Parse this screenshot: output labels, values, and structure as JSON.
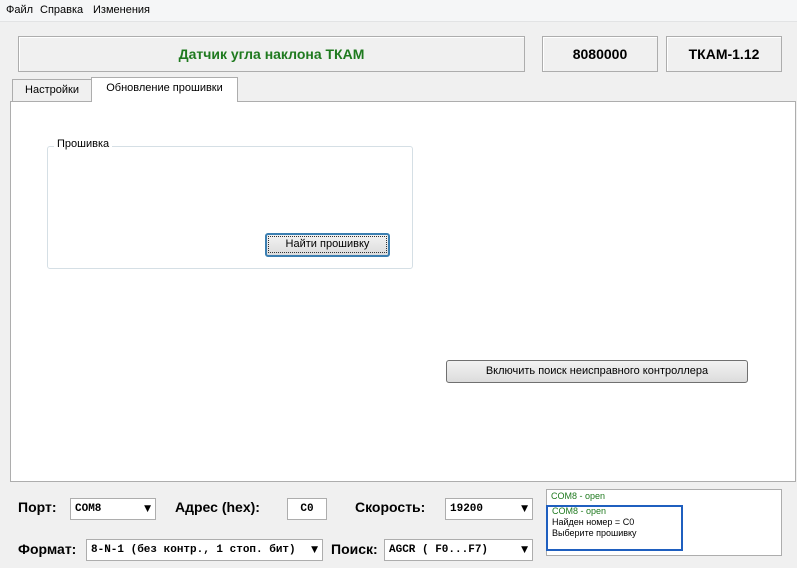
{
  "menu": [
    "Файл",
    "Справка",
    "Изменения"
  ],
  "header": {
    "title": "Датчик угла наклона ТКАМ",
    "serial": "8080000",
    "model": "ТКАМ-1.12"
  },
  "tabs": [
    "Настройки",
    "Обновление прошивки"
  ],
  "active_tab": "Обновление прошивки",
  "firmware": {
    "group_label": "Прошивка",
    "find_button": "Найти прошивку"
  },
  "faulty_button": "Включить поиск неисправного контроллера",
  "bottom": {
    "port_label": "Порт:",
    "port_value": "COM8",
    "address_label": "Адрес (hex):",
    "address_value": "C0",
    "speed_label": "Скорость:",
    "speed_value": "19200",
    "format_label": "Формат:",
    "format_value": "8-N-1 (без контр., 1 стоп. бит)",
    "search_label": "Поиск:",
    "search_value": "AGCR ( F0...F7)"
  },
  "log": [
    {
      "text": "COM8 - open",
      "color": "#1f7a1f"
    },
    {
      "text": "COM8 - open",
      "color": "#1f7a1f"
    },
    {
      "text": "Найден номер = C0",
      "color": "#000000"
    },
    {
      "text": "Выберите прошивку",
      "color": "#000000"
    }
  ]
}
